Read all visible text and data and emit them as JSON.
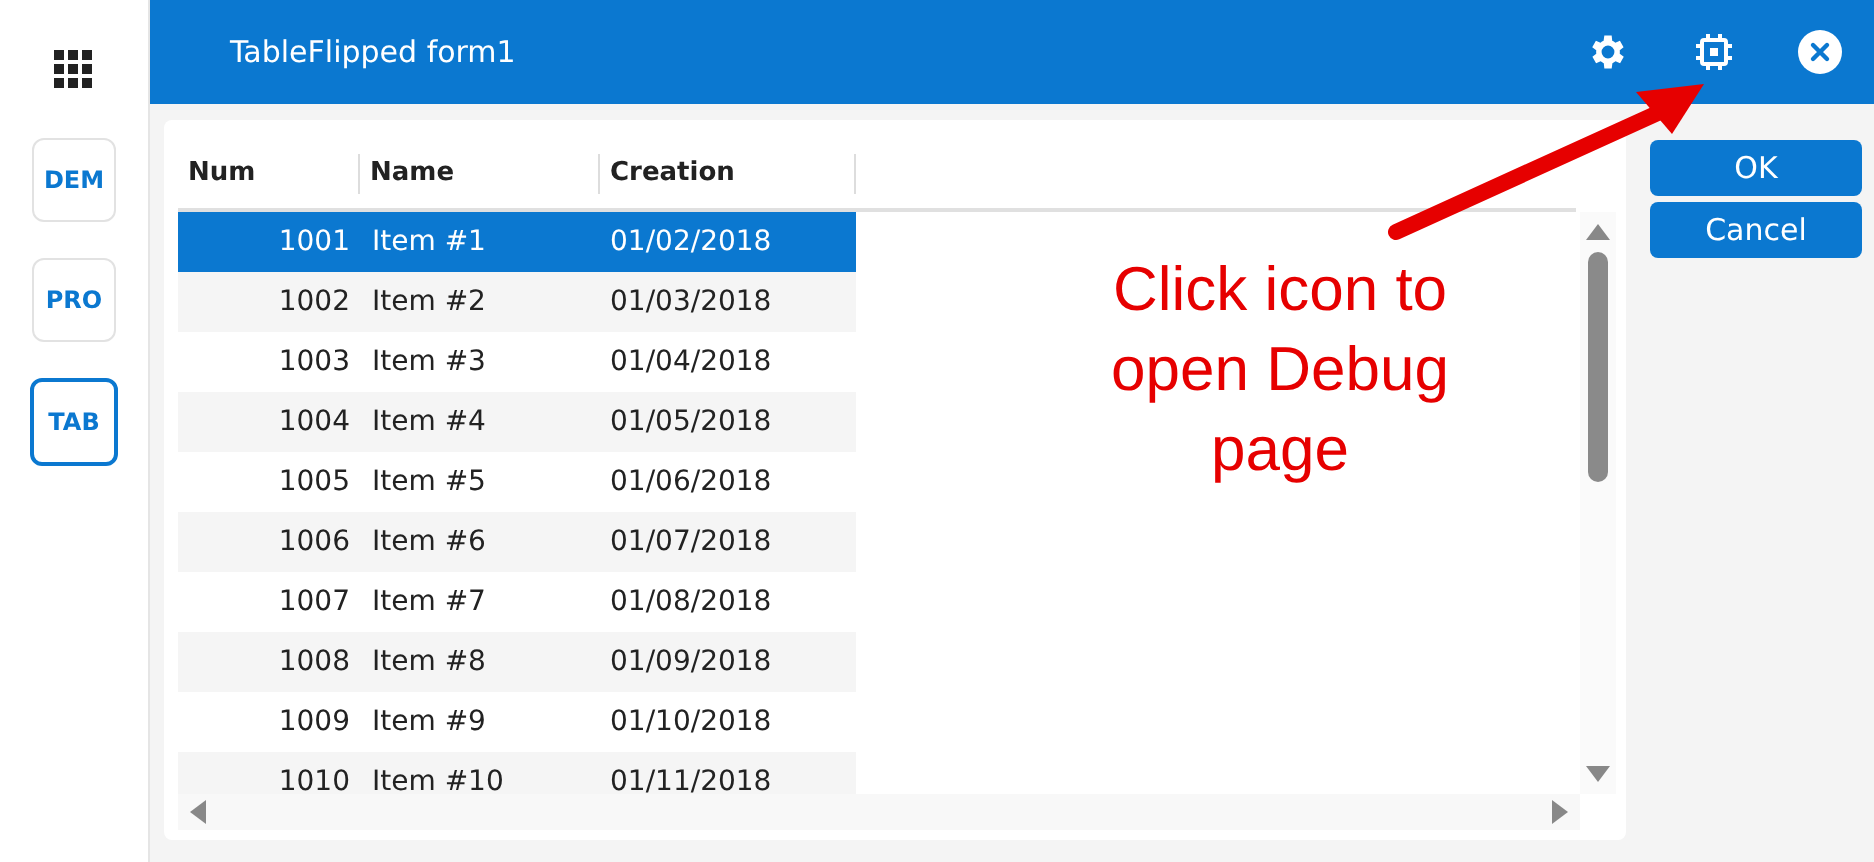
{
  "sidebar": {
    "items": [
      {
        "label": "DEM",
        "selected": false
      },
      {
        "label": "PRO",
        "selected": false
      },
      {
        "label": "TAB",
        "selected": true
      }
    ]
  },
  "header": {
    "title": "TableFlipped form1"
  },
  "table": {
    "columns": [
      "Num",
      "Name",
      "Creation"
    ],
    "rows": [
      {
        "num": "1001",
        "name": "Item #1",
        "creation": "01/02/2018",
        "selected": true
      },
      {
        "num": "1002",
        "name": "Item #2",
        "creation": "01/03/2018",
        "selected": false
      },
      {
        "num": "1003",
        "name": "Item #3",
        "creation": "01/04/2018",
        "selected": false
      },
      {
        "num": "1004",
        "name": "Item #4",
        "creation": "01/05/2018",
        "selected": false
      },
      {
        "num": "1005",
        "name": "Item #5",
        "creation": "01/06/2018",
        "selected": false
      },
      {
        "num": "1006",
        "name": "Item #6",
        "creation": "01/07/2018",
        "selected": false
      },
      {
        "num": "1007",
        "name": "Item #7",
        "creation": "01/08/2018",
        "selected": false
      },
      {
        "num": "1008",
        "name": "Item #8",
        "creation": "01/09/2018",
        "selected": false
      },
      {
        "num": "1009",
        "name": "Item #9",
        "creation": "01/10/2018",
        "selected": false
      },
      {
        "num": "1010",
        "name": "Item #10",
        "creation": "01/11/2018",
        "selected": false
      }
    ]
  },
  "buttons": [
    "OK",
    "Cancel"
  ],
  "annotation": {
    "text": "Click icon to open Debug page"
  }
}
